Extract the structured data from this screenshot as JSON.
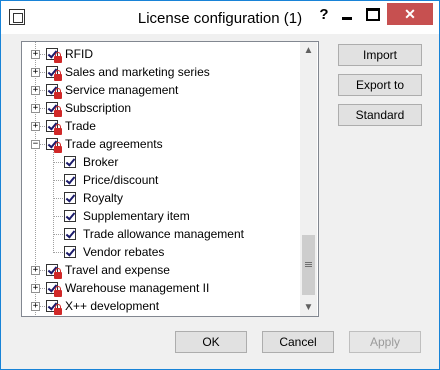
{
  "window": {
    "title": "License configuration (1)"
  },
  "titlebar": {
    "help": "?",
    "close": "✕"
  },
  "tree": {
    "items": [
      {
        "label": "RFID",
        "expander": "+",
        "level": 0
      },
      {
        "label": "Sales and marketing series",
        "expander": "+",
        "level": 0
      },
      {
        "label": "Service management",
        "expander": "+",
        "level": 0
      },
      {
        "label": "Subscription",
        "expander": "+",
        "level": 0
      },
      {
        "label": "Trade",
        "expander": "+",
        "level": 0
      },
      {
        "label": "Trade agreements",
        "expander": "−",
        "level": 0
      },
      {
        "label": "Broker",
        "level": 1
      },
      {
        "label": "Price/discount",
        "level": 1
      },
      {
        "label": "Royalty",
        "level": 1
      },
      {
        "label": "Supplementary item",
        "level": 1
      },
      {
        "label": "Trade allowance management",
        "level": 1
      },
      {
        "label": "Vendor rebates",
        "level": 1
      },
      {
        "label": "Travel and expense",
        "expander": "+",
        "level": 0
      },
      {
        "label": "Warehouse management II",
        "expander": "+",
        "level": 0
      },
      {
        "label": "X++ development",
        "expander": "+",
        "level": 0
      }
    ]
  },
  "scrollbar": {
    "up": "▲",
    "down": "▼"
  },
  "side_buttons": {
    "import": "Import",
    "export": "Export to",
    "standard": "Standard"
  },
  "footer": {
    "ok": "OK",
    "cancel": "Cancel",
    "apply": "Apply"
  }
}
